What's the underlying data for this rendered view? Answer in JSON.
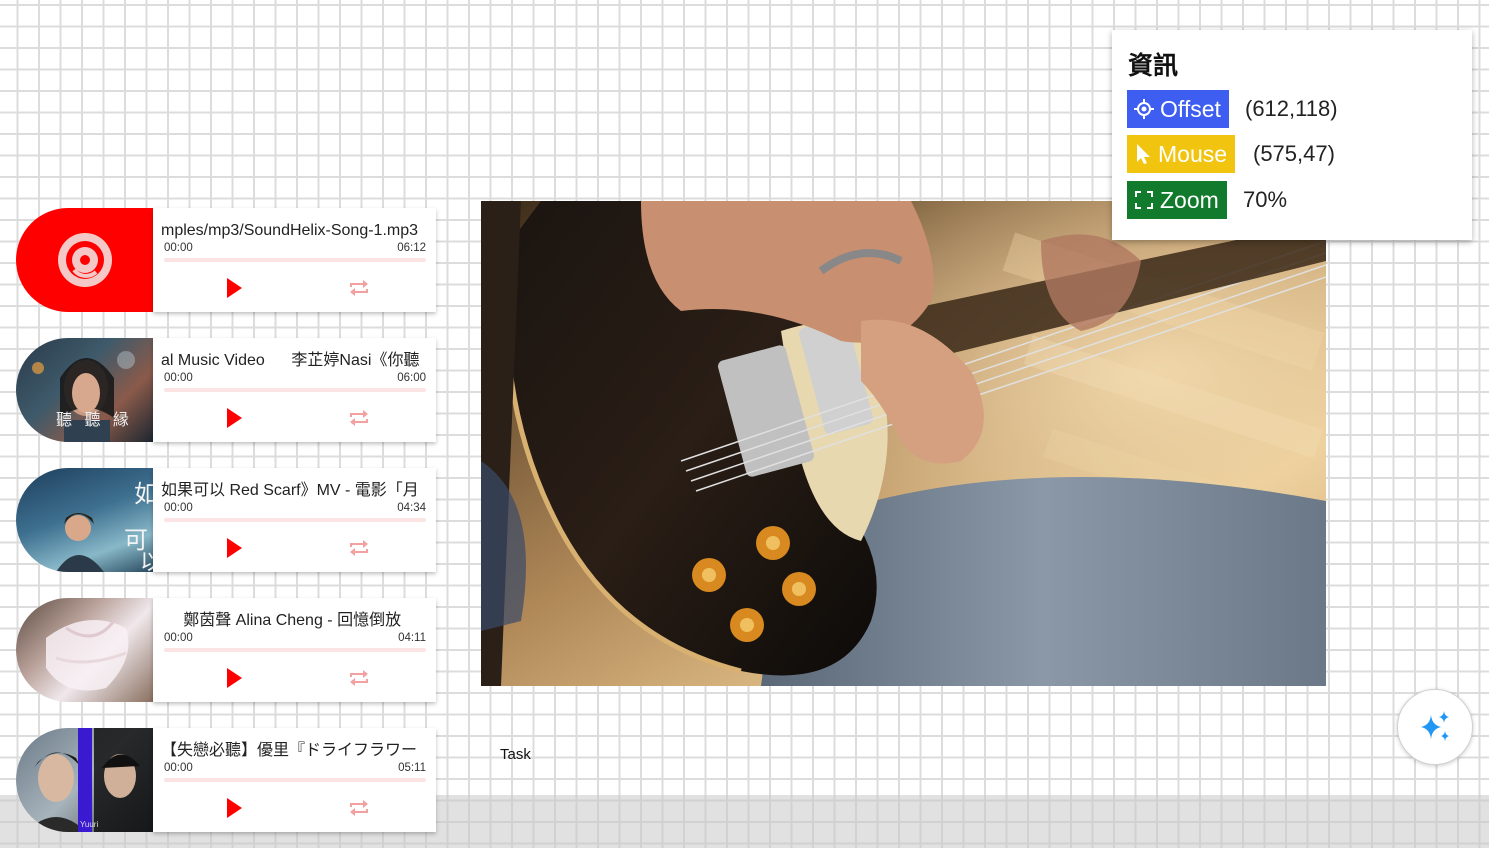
{
  "players": [
    {
      "title": "mples/mp3/SoundHelix-Song-1.mp3",
      "current": "00:00",
      "duration": "06:12"
    },
    {
      "title": "al Music Video      李芷婷Nasi《你聽",
      "current": "00:00",
      "duration": "06:00"
    },
    {
      "title": "如果可以 Red Scarf》MV - 電影「月",
      "current": "00:00",
      "duration": "04:34"
    },
    {
      "title": "     鄭茵聲 Alina Cheng - 回憶倒放",
      "current": "00:00",
      "duration": "04:11"
    },
    {
      "title": "【失戀必聽】優里『ドライフラワー",
      "current": "00:00",
      "duration": "05:11"
    }
  ],
  "cover_text": {
    "cover2": "聽 聽 縁",
    "cover3_top": "如",
    "cover3_mid": "可",
    "cover3_bot": "以",
    "cover5": "Yuuri"
  },
  "task_label": "Task",
  "info": {
    "title": "資訊",
    "offset_label": "Offset",
    "offset_value": "(612,118)",
    "mouse_label": "Mouse",
    "mouse_value": "(575,47)",
    "zoom_label": "Zoom",
    "zoom_value": "70%"
  },
  "colors": {
    "accent_red": "#ff0000",
    "offset_badge": "#3d5ef0",
    "mouse_badge": "#f1c40f",
    "zoom_badge": "#117a2c",
    "fab_icon": "#2196f3"
  },
  "icons": {
    "player_cover_1": "disc-icon",
    "play": "play-icon",
    "repeat": "repeat-icon",
    "offset": "crosshair-icon",
    "mouse": "cursor-icon",
    "zoom": "fullscreen-icon",
    "fab": "sparkle-icon"
  }
}
